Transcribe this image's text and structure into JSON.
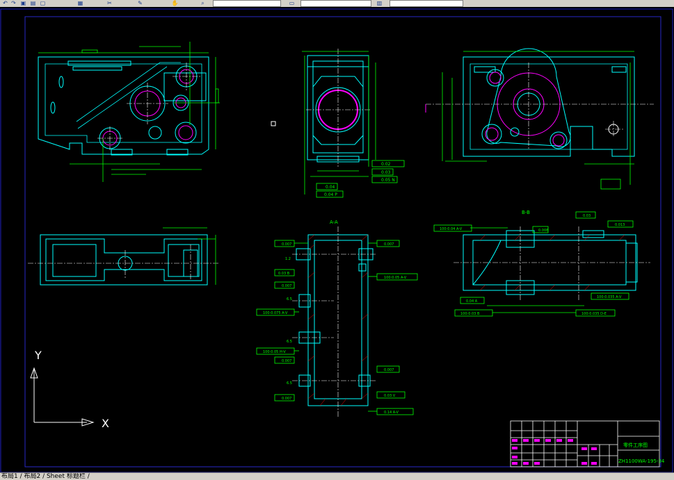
{
  "toolbar": {
    "icons": [
      "undo-icon",
      "redo-icon",
      "save-icon",
      "print-icon",
      "copy-icon",
      "paste-icon",
      "cut-icon",
      "match-icon",
      "pan-icon",
      "zoom-icon",
      "layer-icon"
    ]
  },
  "drawing": {
    "section_aa": "A-A",
    "section_bb": "B-B",
    "title_block": {
      "part_name": "零件工序图",
      "drawing_number": "ZH1100WA-195-34"
    },
    "ucs": {
      "y_label": "Y",
      "x_label": "X"
    },
    "tolerances": {
      "t1": "0.007",
      "t2": "0.007",
      "t3": "0.007",
      "t4": "0.007",
      "t5": "0.007",
      "t6": "0.007",
      "t7": "0.007",
      "t8": "0.007",
      "par1": "100:0.05 A-V",
      "par2": "100:0.075 A-V",
      "par3": "100:0.05 H-V",
      "pos1": "0.03 B",
      "pos2": "0.03 V",
      "pos3": "0.14 A-V",
      "bb1": "0.008",
      "bb2": "0.03",
      "bb3": "0.013",
      "bb4": "100:0.04 A-V",
      "bb5": "0.04 A",
      "bb6": "100:0.035 A-V",
      "bb7": "100:0.03 B",
      "bb8": "100:0.035 D-E",
      "top1": "0.02",
      "top2": "0.03",
      "top3": "0.05 N",
      "top4": "0.04",
      "top5": "0.04 P",
      "dim1": "1.2",
      "dim2": "6.5",
      "dim3": "6.5",
      "dim4": "6.5"
    }
  },
  "tabs": {
    "label": "布局1 / 布局2 / Sheet  标题栏 /"
  },
  "colors": {
    "background": "#000000",
    "frame": "#2828c8",
    "part": "#00ffff",
    "hole": "#ff00ff",
    "dim": "#00ff00",
    "center": "#ffffff"
  }
}
